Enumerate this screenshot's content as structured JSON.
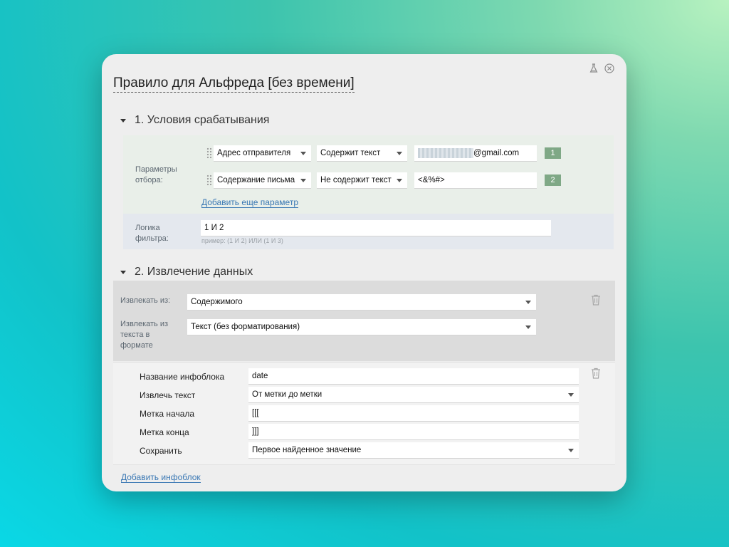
{
  "title": "Правило для Альфреда [без времени]",
  "sections": {
    "conditions": "1. Условия срабатывания",
    "extraction": "2. Извлечение данных"
  },
  "conditions": {
    "params_label": "Параметры отбора:",
    "rows": [
      {
        "field": "Адрес отправителя",
        "operator": "Содержит текст",
        "value": "@gmail.com",
        "index": "1"
      },
      {
        "field": "Содержание письма",
        "operator": "Не содержит текст",
        "value": "<&%#>",
        "index": "2"
      }
    ],
    "add_param": "Добавить еще параметр",
    "logic_label": "Логика фильтра:",
    "logic_value": "1 И 2",
    "logic_hint": "пример: (1 И 2) ИЛИ (1 И 3)"
  },
  "extraction": {
    "from_label": "Извлекать из:",
    "from_value": "Содержимого",
    "format_label": "Извлекать из текста в формате",
    "format_value": "Текст (без форматирования)",
    "infoblock": {
      "name_label": "Название инфоблока",
      "name_value": "date",
      "extract_label": "Извлечь текст",
      "extract_value": "От метки до метки",
      "start_label": "Метка начала",
      "start_value": "[[[",
      "end_label": "Метка конца",
      "end_value": "]]]",
      "save_label": "Сохранить",
      "save_value": "Первое найденное значение"
    },
    "add_infoblock": "Добавить инфоблок"
  },
  "icons": {
    "flask": "flask-icon",
    "close": "close-circle-icon",
    "trash": "trash-icon",
    "grip": "drag-handle-icon"
  },
  "colors": {
    "link": "#3a78b4",
    "index_badge": "#7fa886",
    "conditions_panel": "#e9efe9",
    "logic_panel": "#e4e8ee"
  }
}
